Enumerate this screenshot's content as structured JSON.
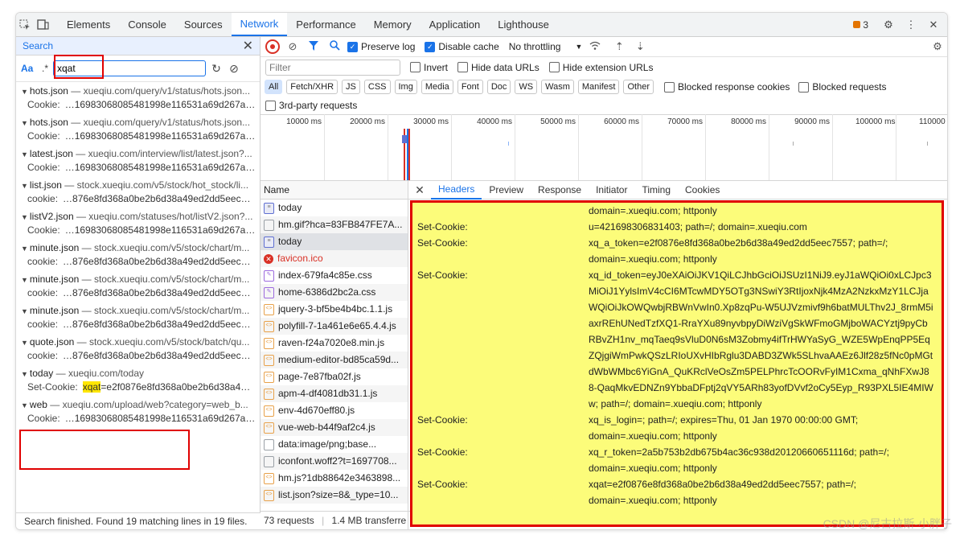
{
  "devtools": {
    "tabs": [
      "Elements",
      "Console",
      "Sources",
      "Network",
      "Performance",
      "Memory",
      "Application",
      "Lighthouse"
    ],
    "active_tab": "Network",
    "issues_count": "3"
  },
  "search": {
    "title": "Search",
    "aa": "Aa",
    "regex": ".*",
    "query": "xqat",
    "results": [
      {
        "file": "hots.json",
        "url": "xueqiu.com/query/v1/status/hots.json...",
        "key": "Cookie:",
        "value": "…16983068085481998e116531a69d267a…"
      },
      {
        "file": "hots.json",
        "url": "xueqiu.com/query/v1/status/hots.json...",
        "key": "Cookie:",
        "value": "…16983068085481998e116531a69d267a…"
      },
      {
        "file": "latest.json",
        "url": "xueqiu.com/interview/list/latest.json?...",
        "key": "Cookie:",
        "value": "…16983068085481998e116531a69d267a…"
      },
      {
        "file": "list.json",
        "url": "stock.xueqiu.com/v5/stock/hot_stock/li...",
        "key": "cookie:",
        "value": "…876e8fd368a0be2b6d38a49ed2dd5eec…"
      },
      {
        "file": "listV2.json",
        "url": "xueqiu.com/statuses/hot/listV2.json?...",
        "key": "Cookie:",
        "value": "…16983068085481998e116531a69d267a…"
      },
      {
        "file": "minute.json",
        "url": "stock.xueqiu.com/v5/stock/chart/m...",
        "key": "cookie:",
        "value": "…876e8fd368a0be2b6d38a49ed2dd5eec…"
      },
      {
        "file": "minute.json",
        "url": "stock.xueqiu.com/v5/stock/chart/m...",
        "key": "cookie:",
        "value": "…876e8fd368a0be2b6d38a49ed2dd5eec…"
      },
      {
        "file": "minute.json",
        "url": "stock.xueqiu.com/v5/stock/chart/m...",
        "key": "cookie:",
        "value": "…876e8fd368a0be2b6d38a49ed2dd5eec…"
      },
      {
        "file": "quote.json",
        "url": "stock.xueqiu.com/v5/stock/batch/qu...",
        "key": "cookie:",
        "value": "…876e8fd368a0be2b6d38a49ed2dd5eec…"
      },
      {
        "file": "today",
        "url": "xueqiu.com/today",
        "key": "Set-Cookie:",
        "match": "xqat",
        "value": "=e2f0876e8fd368a0be2b6d38a4…"
      },
      {
        "file": "web",
        "url": "xueqiu.com/upload/web?category=web_b...",
        "key": "Cookie:",
        "value": "…16983068085481998e116531a69d267a…"
      }
    ],
    "status": "Search finished.  Found 19 matching lines in 19 files."
  },
  "toolbar": {
    "preserve_log": "Preserve log",
    "disable_cache": "Disable cache",
    "throttling": "No throttling",
    "filter_placeholder": "Filter",
    "invert": "Invert",
    "hide_data_urls": "Hide data URLs",
    "hide_ext_urls": "Hide extension URLs",
    "types": [
      "All",
      "Fetch/XHR",
      "JS",
      "CSS",
      "Img",
      "Media",
      "Font",
      "Doc",
      "WS",
      "Wasm",
      "Manifest",
      "Other"
    ],
    "blocked_cookies": "Blocked response cookies",
    "blocked_requests": "Blocked requests",
    "third_party": "3rd-party requests"
  },
  "timeline": {
    "ticks": [
      "10000 ms",
      "20000 ms",
      "30000 ms",
      "40000 ms",
      "50000 ms",
      "60000 ms",
      "70000 ms",
      "80000 ms",
      "90000 ms",
      "100000 ms",
      "110000 ms"
    ]
  },
  "requests": {
    "header": "Name",
    "items": [
      {
        "name": "today",
        "type": "doc"
      },
      {
        "name": "hm.gif?hca=83FB847FE7A...",
        "type": "img"
      },
      {
        "name": "today",
        "type": "doc",
        "selected": true
      },
      {
        "name": "favicon.ico",
        "type": "err"
      },
      {
        "name": "index-679fa4c85e.css",
        "type": "css"
      },
      {
        "name": "home-6386d2bc2a.css",
        "type": "css"
      },
      {
        "name": "jquery-3-bf5be4b4bc.1.1.js",
        "type": "js"
      },
      {
        "name": "polyfill-7-1a461e6e65.4.4.js",
        "type": "js"
      },
      {
        "name": "raven-f24a7020e8.min.js",
        "type": "js"
      },
      {
        "name": "medium-editor-bd85ca59d...",
        "type": "js"
      },
      {
        "name": "page-7e87fba02f.js",
        "type": "js"
      },
      {
        "name": "apm-4-df4081db31.1.js",
        "type": "js"
      },
      {
        "name": "env-4d670eff80.js",
        "type": "js"
      },
      {
        "name": "vue-web-b44f9af2c4.js",
        "type": "js"
      },
      {
        "name": "data:image/png;base...",
        "type": "img"
      },
      {
        "name": "iconfont.woff2?t=1697708...",
        "type": "img"
      },
      {
        "name": "hm.js?1db88642e3463898...",
        "type": "js"
      },
      {
        "name": "list.json?size=8&_type=10...",
        "type": "js"
      }
    ],
    "count": "73 requests",
    "transferred": "1.4 MB transferre"
  },
  "details": {
    "tabs": [
      "Headers",
      "Preview",
      "Response",
      "Initiator",
      "Timing",
      "Cookies"
    ],
    "active_tab": "Headers",
    "headers": [
      {
        "name": "",
        "value": "domain=.xueqiu.com; httponly"
      },
      {
        "name": "Set-Cookie:",
        "value": "u=421698306831403; path=/; domain=.xueqiu.com"
      },
      {
        "name": "Set-Cookie:",
        "value": "xq_a_token=e2f0876e8fd368a0be2b6d38a49ed2dd5eec7557; path=/;"
      },
      {
        "name": "",
        "value": "domain=.xueqiu.com; httponly"
      },
      {
        "name": "Set-Cookie:",
        "value": "xq_id_token=eyJ0eXAiOiJKV1QiLCJhbGciOiJSUzI1NiJ9.eyJ1aWQiOi0xLCJpc3MiOiJ1YylsImV4cCI6MTcwMDY5OTg3NSwiY3RtIjoxNjk4MzA2NzkxMzY1LCJjaWQiOiJkOWQwbjRBWnVwIn0.Xp8zqPu-W5UJVzmivf9h6batMULThv2J_8rmM5iaxrREhUNedTzfXQ1-RraYXu89nyvbpyDiWziVgSkWFmoGMjboWACYztj9pyCbRBvZH1nv_mqTaeq9sVluD0N6sM3Zobmy4ifTrHWYaSyG_WZE5WpEnqPP5EqZQjgiWmPwkQSzLRIoUXvHIbRglu3DABD3ZWk5SLhvaAAEz6Jlf28z5fNc0pMGtdWbWMbc6YiGnA_QuKRclVeOsZm5PELPhrcTcOORvFyIM1Cxma_qNhFXwJ88-QaqMkvEDNZn9YbbaDFptj2qVY5ARh83yofDVvf2oCy5Eyp_R93PXL5IE4MIWw; path=/; domain=.xueqiu.com; httponly"
      },
      {
        "name": "Set-Cookie:",
        "value": "xq_is_login=; path=/; expires=Thu, 01 Jan 1970 00:00:00 GMT;"
      },
      {
        "name": "",
        "value": "domain=.xueqiu.com; httponly"
      },
      {
        "name": "Set-Cookie:",
        "value": "xq_r_token=2a5b753b2db675b4ac36c938d20120660651116d; path=/;"
      },
      {
        "name": "",
        "value": "domain=.xueqiu.com; httponly"
      },
      {
        "name": "Set-Cookie:",
        "value": "xqat=e2f0876e8fd368a0be2b6d38a49ed2dd5eec7557; path=/;"
      },
      {
        "name": "",
        "value": "domain=.xueqiu.com; httponly"
      }
    ]
  },
  "watermark": "CSDN @尼古拉斯-小胖子"
}
